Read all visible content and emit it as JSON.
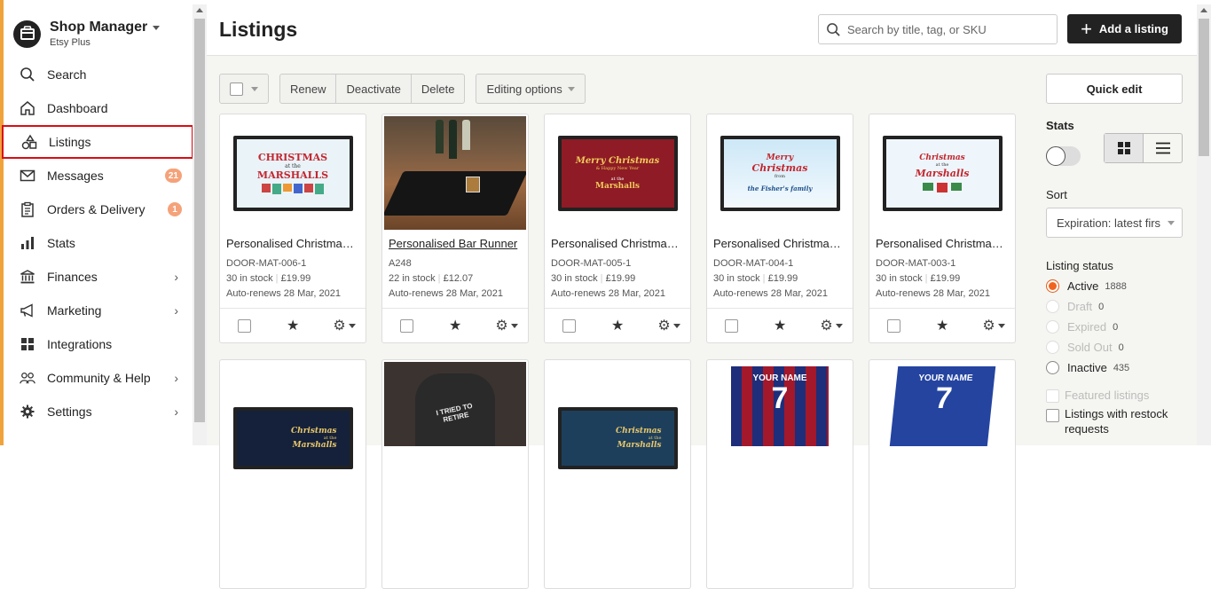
{
  "shop": {
    "name": "Shop Manager",
    "plan": "Etsy Plus"
  },
  "nav": [
    {
      "label": "Search",
      "icon": "search-icon"
    },
    {
      "label": "Dashboard",
      "icon": "home-icon"
    },
    {
      "label": "Listings",
      "icon": "listings-icon",
      "active": true
    },
    {
      "label": "Messages",
      "icon": "mail-icon",
      "badge": "21"
    },
    {
      "label": "Orders & Delivery",
      "icon": "clipboard-icon",
      "badge": "1"
    },
    {
      "label": "Stats",
      "icon": "bar-chart-icon"
    },
    {
      "label": "Finances",
      "icon": "bank-icon",
      "chevron": true
    },
    {
      "label": "Marketing",
      "icon": "megaphone-icon",
      "chevron": true
    },
    {
      "label": "Integrations",
      "icon": "grid-icon"
    },
    {
      "label": "Community & Help",
      "icon": "people-icon",
      "chevron": true
    },
    {
      "label": "Settings",
      "icon": "gear-icon",
      "chevron": true
    }
  ],
  "header": {
    "title": "Listings",
    "search_placeholder": "Search by title, tag, or SKU",
    "add_label": "Add a listing"
  },
  "toolbar": {
    "renew": "Renew",
    "deactivate": "Deactivate",
    "delete": "Delete",
    "editing": "Editing options"
  },
  "listings": [
    {
      "title": "Personalised Christmas Door Mat",
      "sku": "DOOR-MAT-006-1",
      "stock": "30 in stock",
      "price": "£19.99",
      "renew": "Auto-renews 28 Mar, 2021"
    },
    {
      "title": "Personalised Bar Runner",
      "sku": "A248",
      "stock": "22 in stock",
      "price": "£12.07",
      "renew": "Auto-renews 28 Mar, 2021"
    },
    {
      "title": "Personalised Christmas Door Mat",
      "sku": "DOOR-MAT-005-1",
      "stock": "30 in stock",
      "price": "£19.99",
      "renew": "Auto-renews 28 Mar, 2021"
    },
    {
      "title": "Personalised Christmas Door Mat",
      "sku": "DOOR-MAT-004-1",
      "stock": "30 in stock",
      "price": "£19.99",
      "renew": "Auto-renews 28 Mar, 2021"
    },
    {
      "title": "Personalised Christmas Door Mat",
      "sku": "DOOR-MAT-003-1",
      "stock": "30 in stock",
      "price": "£19.99",
      "renew": "Auto-renews 28 Mar, 2021"
    }
  ],
  "mats": {
    "m1": {
      "a": "CHRISTMAS",
      "b": "at the",
      "c": "MARSHALLS"
    },
    "m3": {
      "a": "Merry Christmas",
      "b": "& Happy New Year",
      "c": "at the",
      "d": "Marshalls"
    },
    "m4": {
      "a": "Merry",
      "b": "Christmas",
      "c": "from",
      "d": "the Fisher's family"
    },
    "m5": {
      "a": "Christmas",
      "b": "at the",
      "c": "Marshalls"
    },
    "r1": {
      "a": "Christmas",
      "b": "at the",
      "c": "Marshalls"
    },
    "r3": {
      "a": "Christmas",
      "b": "at the",
      "c": "Marshalls"
    },
    "r4": {
      "a": "YOUR NAME",
      "b": "7"
    },
    "r5": {
      "a": "YOUR NAME",
      "b": "7"
    },
    "r2": {
      "a": "I TRIED TO RETIRE"
    }
  },
  "panel": {
    "quick_edit": "Quick edit",
    "stats_label": "Stats",
    "sort_label": "Sort",
    "sort_value": "Expiration: latest first",
    "status_label": "Listing status",
    "statuses": [
      {
        "label": "Active",
        "count": "1888",
        "selected": true
      },
      {
        "label": "Draft",
        "count": "0",
        "disabled": true
      },
      {
        "label": "Expired",
        "count": "0",
        "disabled": true
      },
      {
        "label": "Sold Out",
        "count": "0",
        "disabled": true
      },
      {
        "label": "Inactive",
        "count": "435"
      }
    ],
    "featured": "Featured listings",
    "restock": "Listings with restock requests"
  },
  "colors": {
    "accent": "#f1641e",
    "sidebar_stripe": "#f1a33b",
    "highlight": "#d90d14"
  }
}
